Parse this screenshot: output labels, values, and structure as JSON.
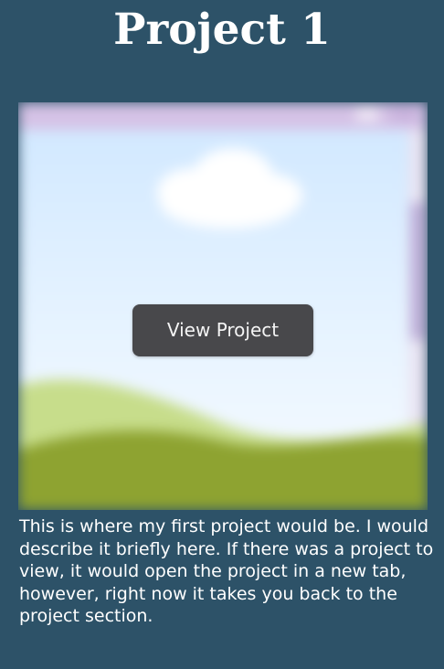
{
  "project": {
    "title": "Project 1",
    "view_button_label": "View Project",
    "description": "This is where my first project would be. I would describe it briefly here. If there was a project to view, it would open the project in a new tab, however, right now it takes you back to the project section."
  },
  "preview": {
    "image_name": "blurred-desktop-wallpaper",
    "icons": [
      "cloud-icon"
    ]
  },
  "colors": {
    "background": "#2d5268",
    "button_background": "#48484b",
    "text": "#ffffff",
    "window_titlebar": "#d5c2e6",
    "sky": "#dcefff",
    "hill_light": "#c7dd8b",
    "hill_dark": "#8ea331"
  }
}
